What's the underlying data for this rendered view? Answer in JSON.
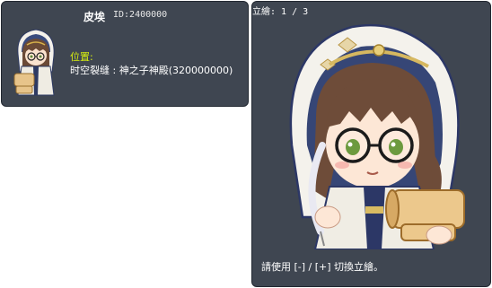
{
  "info": {
    "name": "皮埃",
    "id_text": "ID:2400000",
    "location_label": "位置:",
    "location_value": "时空裂缝 : 神之子神殿(320000000)"
  },
  "portrait": {
    "counter": "立繪: 1 / 3",
    "hint": "請使用 [-] / [+] 切換立繪。"
  },
  "colors": {
    "panel_bg": "#3f4651",
    "location_label": "#d9f00f"
  }
}
